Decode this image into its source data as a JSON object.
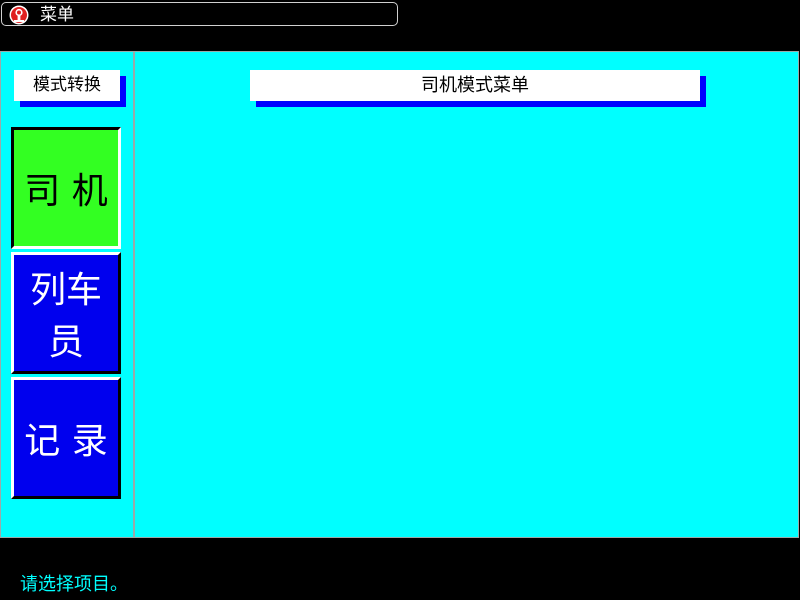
{
  "titlebar": {
    "title": "菜单",
    "logo_icon": "railway-logo-icon"
  },
  "sidebar": {
    "header": "模式转换",
    "items": [
      {
        "label": "司 机",
        "state": "selected",
        "color": "#33ff22"
      },
      {
        "label": "列车员",
        "state": "normal",
        "color": "#0000ee"
      },
      {
        "label": "记 录",
        "state": "normal",
        "color": "#0000ee"
      }
    ]
  },
  "main": {
    "title": "司机模式菜单"
  },
  "status": {
    "message": "请选择项目。"
  },
  "colors": {
    "background": "#000000",
    "panel": "#00ffff",
    "shadow": "#0000ff",
    "selected": "#33ff22",
    "button": "#0000ee",
    "status_text": "#00ffff"
  }
}
